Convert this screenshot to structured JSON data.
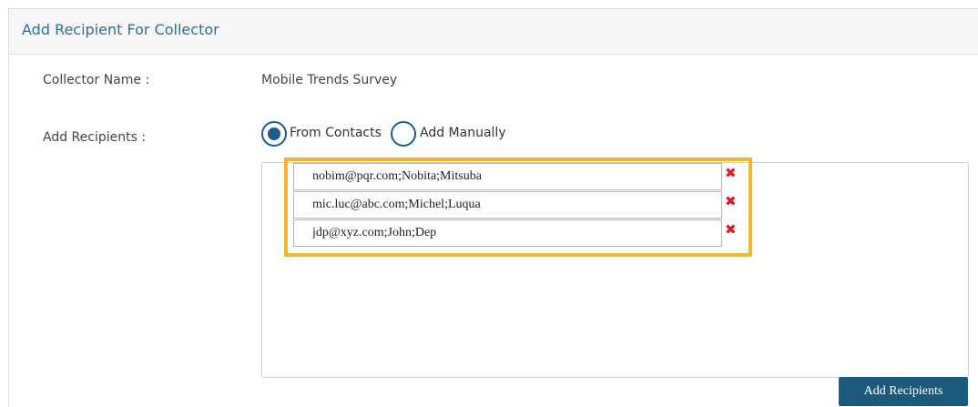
{
  "header": {
    "title": "Add Recipient For Collector"
  },
  "collector": {
    "label": "Collector Name :",
    "value": "Mobile Trends Survey"
  },
  "recipients_section": {
    "label": "Add Recipients :",
    "options": [
      {
        "label": "From Contacts",
        "checked": true
      },
      {
        "label": "Add Manually",
        "checked": false
      }
    ],
    "entries": [
      {
        "value": "nobim@pqr.com;Nobita;Mitsuba",
        "delete_icon": "✖"
      },
      {
        "value": "mic.luc@abc.com;Michel;Luqua",
        "delete_icon": "✖"
      },
      {
        "value": "jdp@xyz.com;John;Dep",
        "delete_icon": "✖"
      }
    ],
    "highlight_color": "#f0b72f",
    "delete_color": "#e0181e"
  },
  "actions": {
    "add_label": "Add Recipients"
  },
  "colors": {
    "accent": "#1a5f8a",
    "button": "#1b5a7c",
    "title": "#31708f"
  }
}
